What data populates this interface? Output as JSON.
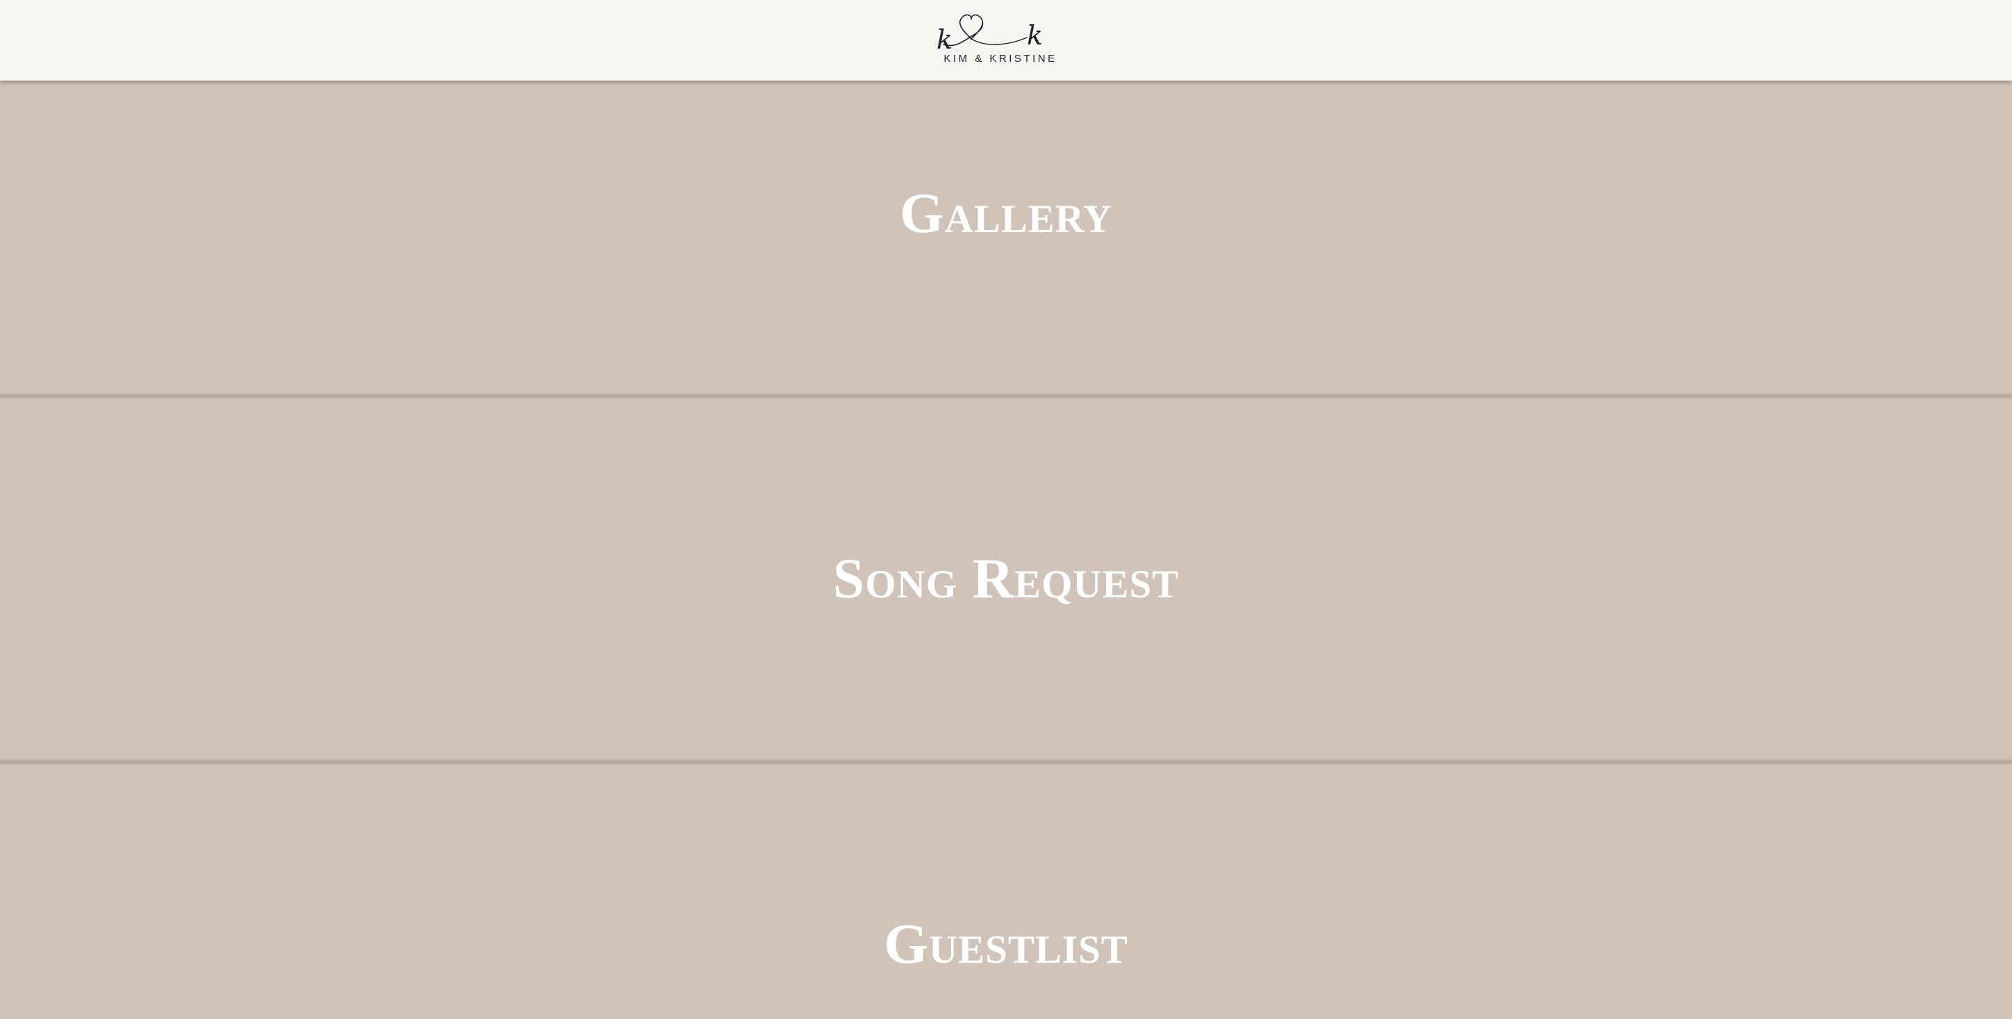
{
  "header": {
    "logo": {
      "monogram_left": "k",
      "monogram_right": "k",
      "icon": "heart-icon",
      "text": "KIM & KRISTINE"
    }
  },
  "sections": [
    {
      "title": "Gallery"
    },
    {
      "title": "Song Request"
    },
    {
      "title": "Guestlist"
    }
  ],
  "colors": {
    "header_bg": "#f6f5f1",
    "panel_bg": "#d0c3b9",
    "title_text": "#ffffff",
    "logo_ink": "#222222"
  }
}
